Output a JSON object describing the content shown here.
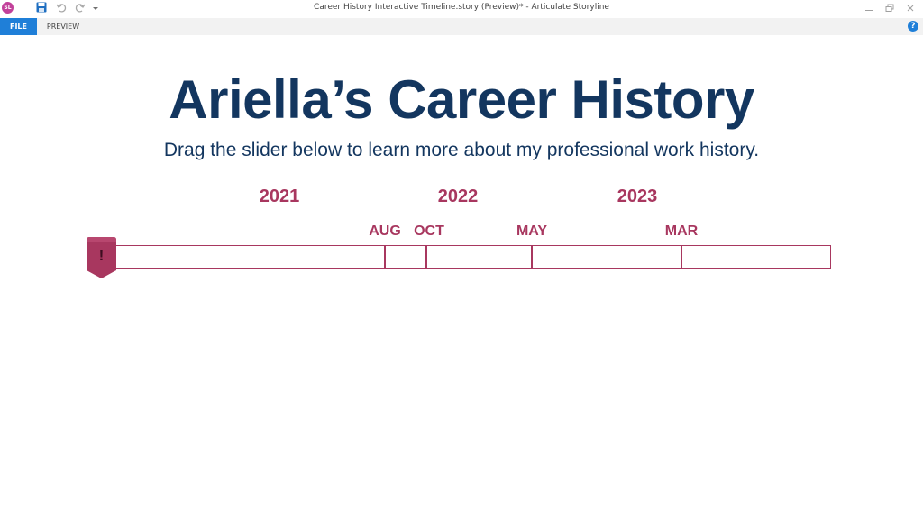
{
  "window": {
    "title": "Career History Interactive Timeline.story (Preview)*  -  Articulate Storyline",
    "logo_text": "SL"
  },
  "ribbon": {
    "tabs": [
      {
        "label": "FILE",
        "active": true
      },
      {
        "label": "PREVIEW",
        "active": false
      }
    ],
    "help_label": "?"
  },
  "slide": {
    "title": "Ariella’s Career History",
    "subtitle": "Drag the slider below to learn more about my professional work history.",
    "timeline": {
      "years": [
        "2021",
        "2022",
        "2023"
      ],
      "months": [
        "AUG",
        "OCT",
        "MAY",
        "MAR"
      ],
      "handle_label": "!"
    }
  },
  "colors": {
    "title": "#13365f",
    "accent": "#a8375f",
    "handle_fill": "#a8375f",
    "tab_active": "#1f7fd8"
  },
  "icons": {
    "logo": "storyline-logo-icon",
    "save": "save-icon",
    "undo": "undo-icon",
    "redo": "redo-icon",
    "customize": "customize-toolbar-icon",
    "minimize": "minimize-icon",
    "restore": "restore-icon",
    "close": "close-icon",
    "help": "help-icon"
  }
}
